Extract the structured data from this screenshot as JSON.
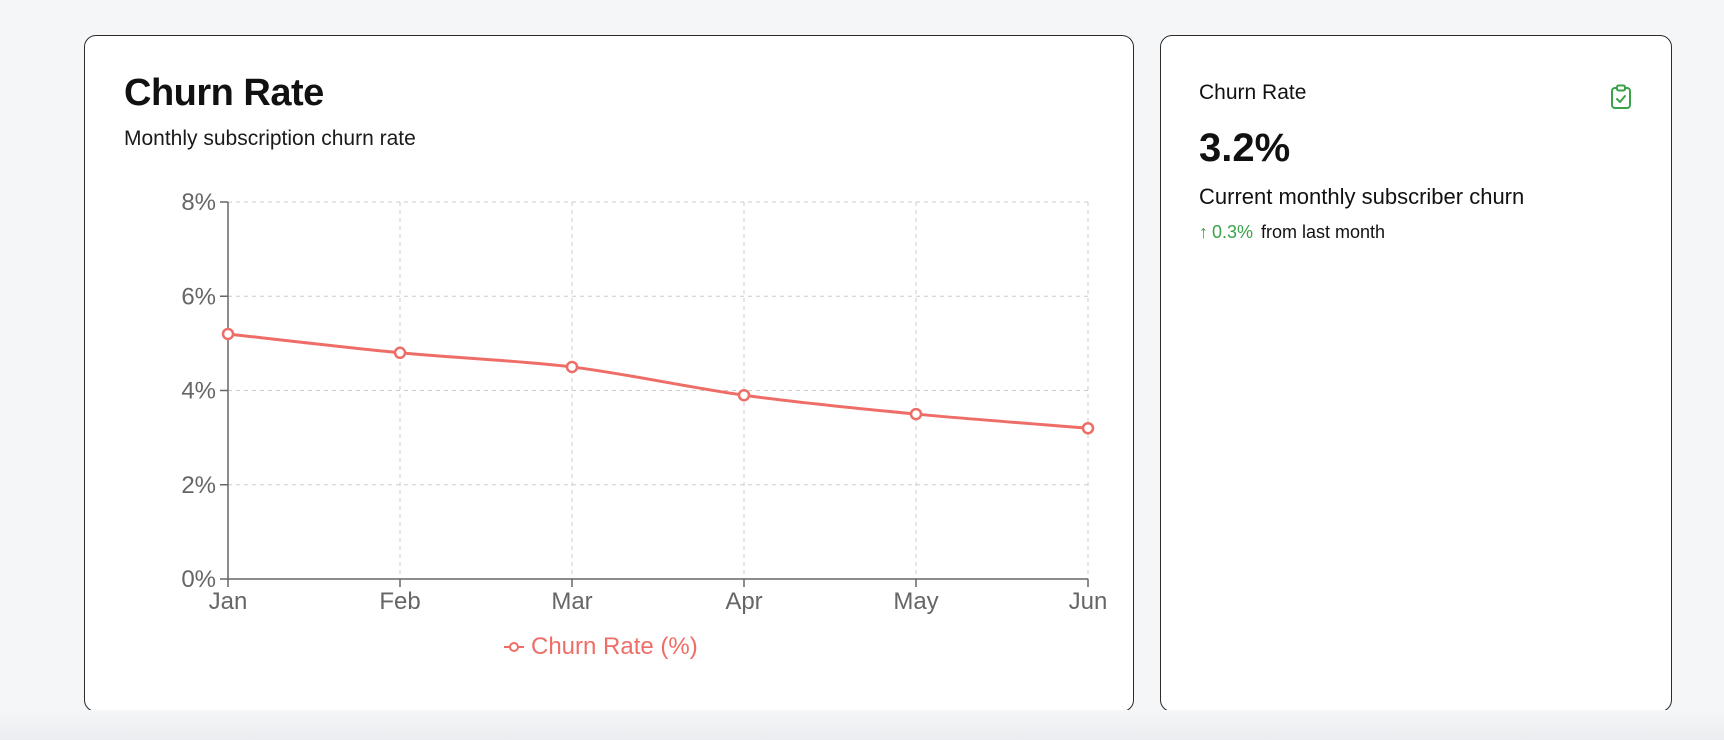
{
  "chart_card": {
    "title": "Churn Rate",
    "subtitle": "Monthly subscription churn rate",
    "legend_label": "Churn Rate (%)"
  },
  "kpi_card": {
    "label": "Churn Rate",
    "icon": "clipboard-check-icon",
    "value": "3.2%",
    "description": "Current monthly subscriber churn",
    "change_arrow": "↑",
    "change_value": "0.3%",
    "change_text": "from last month"
  },
  "colors": {
    "series": "#ee6e67",
    "positive": "#3aa24a",
    "grid": "#cccccc",
    "axis": "#666666"
  },
  "chart_data": {
    "type": "line",
    "title": "Churn Rate",
    "subtitle": "Monthly subscription churn rate",
    "categories": [
      "Jan",
      "Feb",
      "Mar",
      "Apr",
      "May",
      "Jun"
    ],
    "series": [
      {
        "name": "Churn Rate (%)",
        "values": [
          5.2,
          4.8,
          4.5,
          3.9,
          3.5,
          3.2
        ]
      }
    ],
    "ylim": [
      0,
      8
    ],
    "yticks": [
      0,
      2,
      4,
      6,
      8
    ],
    "ytick_labels": [
      "0%",
      "2%",
      "4%",
      "6%",
      "8%"
    ],
    "grid": true,
    "legend": "bottom-center"
  }
}
